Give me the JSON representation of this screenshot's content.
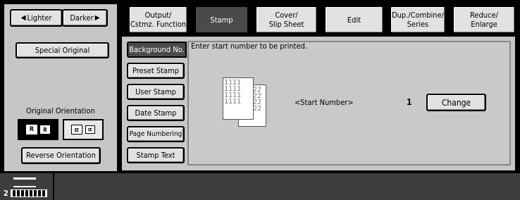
{
  "density": {
    "lighter_label": "Lighter",
    "darker_label": "Darker"
  },
  "left": {
    "special_original_label": "Special Original",
    "orientation_heading": "Original Orientation",
    "orient_a_glyphs": [
      "R",
      "R"
    ],
    "orient_b_glyphs": [
      "ㄸ",
      "ㄸ"
    ],
    "reverse_label": "Reverse Orientation"
  },
  "tabs": [
    {
      "label": "Output/\nCstmz. Function",
      "active": false
    },
    {
      "label": "Stamp",
      "active": true
    },
    {
      "label": "Cover/\nSlip Sheet",
      "active": false
    },
    {
      "label": "Edit",
      "active": false
    },
    {
      "label": "Dup./Combine/\nSeries",
      "active": false
    },
    {
      "label": "Reduce/\nEnlarge",
      "active": false
    }
  ],
  "stamp_menu": [
    {
      "label": "Background No.",
      "selected": true
    },
    {
      "label": "Preset Stamp",
      "selected": false
    },
    {
      "label": "User Stamp",
      "selected": false
    },
    {
      "label": "Date Stamp",
      "selected": false
    },
    {
      "label": "Page Numbering",
      "selected": false
    },
    {
      "label": "Stamp Text",
      "selected": false
    }
  ],
  "content": {
    "instruction": "Enter start number to be printed.",
    "preview_front": [
      "1111",
      "1111",
      "1111",
      "1111"
    ],
    "preview_back": [
      "22",
      "22",
      "22",
      "22"
    ],
    "start_number_label": "<Start Number>",
    "start_number_value": "1",
    "change_label": "Change"
  },
  "status": {
    "counter": "2"
  }
}
